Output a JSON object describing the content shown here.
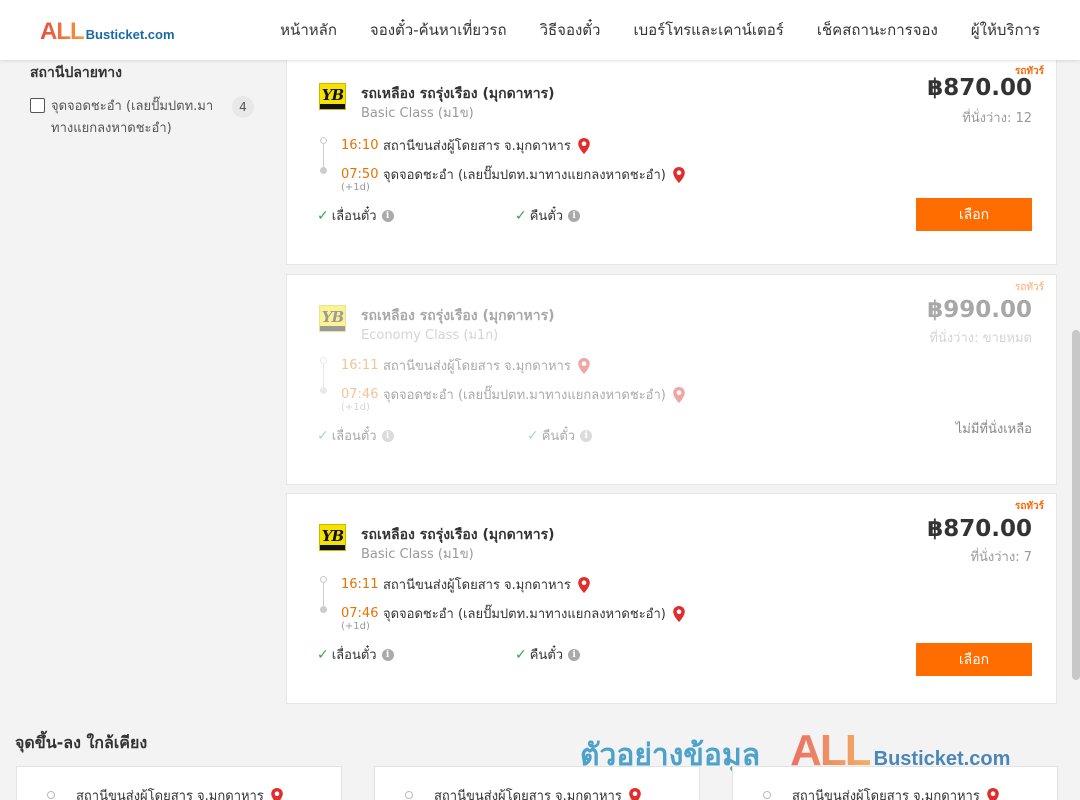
{
  "header": {
    "logo_all": "ALL",
    "logo_rest": "Busticket.com",
    "nav": [
      "หน้าหลัก",
      "จองตั๋ว-ค้นหาเที่ยวรถ",
      "วิธีจองตั๋ว",
      "เบอร์โทรและเคาน์เตอร์",
      "เช็คสถานะการจอง",
      "ผู้ให้บริการ"
    ]
  },
  "sidebar": {
    "title": "สถานีปลายทาง",
    "option": {
      "label": "จุดจอดชะอำ (เลยปั๊มปตท.มาทางแยกลงหาดชะอำ)",
      "count": "4",
      "checked": false
    }
  },
  "trips": [
    {
      "corner": "รถทัวร์",
      "operator": "รถเหลือง รถรุ่งเรือง (มุกดาหาร)",
      "class": "Basic Class (ม1ข)",
      "price": "฿870.00",
      "seats": "ที่นั่งว่าง: 12",
      "depart_time": "16:10",
      "depart_place": "สถานีขนส่งผู้โดยสาร จ.มุกดาหาร",
      "arrive_time": "07:50",
      "arrive_place": "จุดจอดชะอำ (เลยปั๊มปตท.มาทางแยกลงหาดชะอำ)",
      "plus_day": "(+1d)",
      "policy1": "เลื่อนตั๋ว",
      "policy2": "คืนตั๋ว",
      "button": "เลือก",
      "available": true
    },
    {
      "corner": "รถทัวร์",
      "operator": "รถเหลือง รถรุ่งเรือง (มุกดาหาร)",
      "class": "Economy Class (ม1ก)",
      "price": "฿990.00",
      "seats": "ที่นั่งว่าง: ขายหมด",
      "depart_time": "16:11",
      "depart_place": "สถานีขนส่งผู้โดยสาร จ.มุกดาหาร",
      "arrive_time": "07:46",
      "arrive_place": "จุดจอดชะอำ (เลยปั๊มปตท.มาทางแยกลงหาดชะอำ)",
      "plus_day": "(+1d)",
      "policy1": "เลื่อนตั๋ว",
      "policy2": "คืนตั๋ว",
      "no_seats": "ไม่มีที่นั่งเหลือ",
      "available": false
    },
    {
      "corner": "รถทัวร์",
      "operator": "รถเหลือง รถรุ่งเรือง (มุกดาหาร)",
      "class": "Basic Class (ม1ข)",
      "price": "฿870.00",
      "seats": "ที่นั่งว่าง: 7",
      "depart_time": "16:11",
      "depart_place": "สถานีขนส่งผู้โดยสาร จ.มุกดาหาร",
      "arrive_time": "07:46",
      "arrive_place": "จุดจอดชะอำ (เลยปั๊มปตท.มาทางแยกลงหาดชะอำ)",
      "plus_day": "(+1d)",
      "policy1": "เลื่อนตั๋ว",
      "policy2": "คืนตั๋ว",
      "button": "เลือก",
      "available": true
    }
  ],
  "nearby": {
    "title": "จุดขึ้น-ลง ใกล้เคียง",
    "items": [
      "สถานีขนส่งผู้โดยสาร จ.มุกดาหาร",
      "สถานีขนส่งผู้โดยสาร จ.มุกดาหาร",
      "สถานีขนส่งผู้โดยสาร จ.มุกดาหาร"
    ]
  },
  "watermark": {
    "text": "ตัวอย่างข้อมูล",
    "all": "ALL",
    "rest": "Busticket.com"
  },
  "colors": {
    "accent": "#ff6c00",
    "time": "#e67300",
    "check": "#2fa84f",
    "pin": "#e02d2d",
    "watermark_blue": "#1e8cbf"
  }
}
